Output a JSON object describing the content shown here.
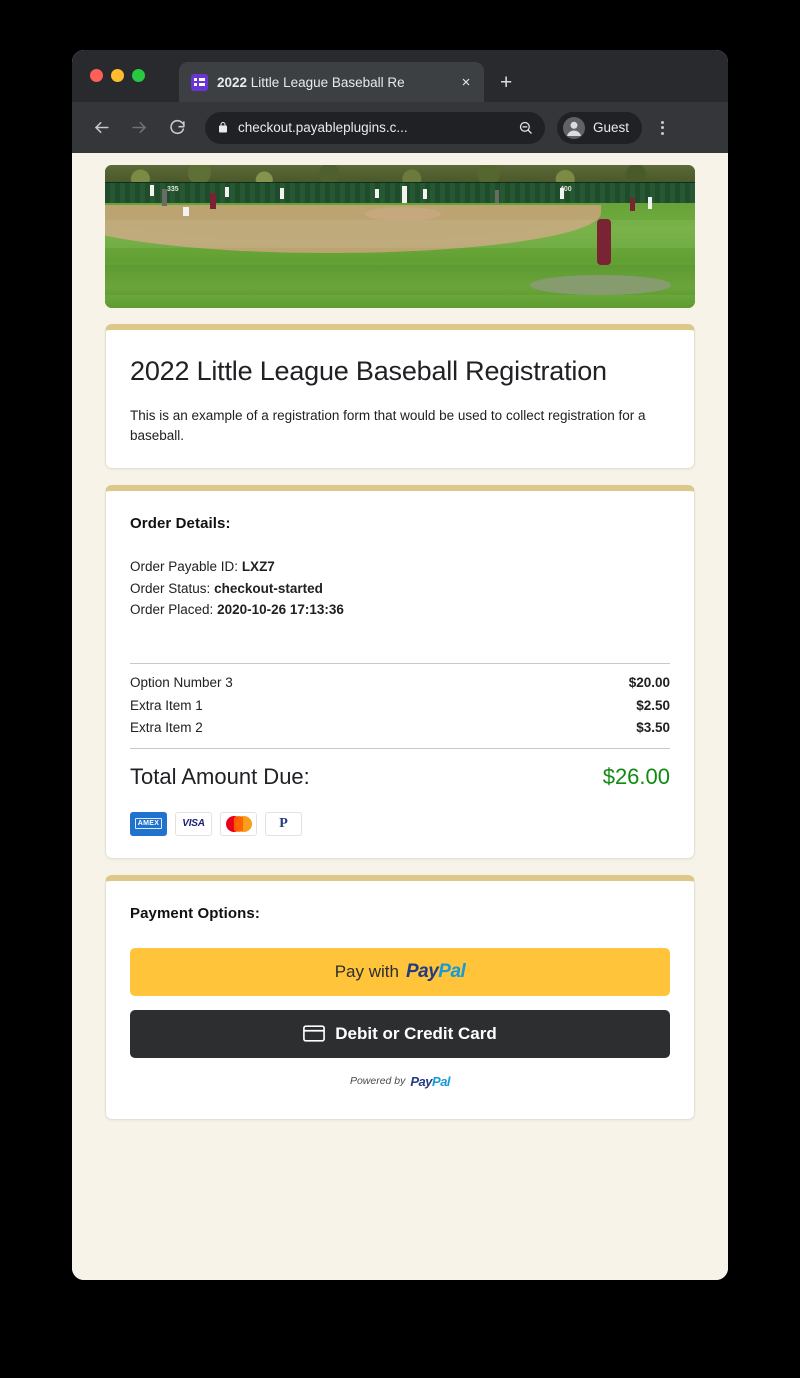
{
  "browser": {
    "tab": {
      "title_bold": "2022",
      "title_rest": " Little League Baseball Re",
      "favicon_name": "forms-list-icon",
      "close_label": "×",
      "new_tab_label": "+"
    },
    "toolbar": {
      "back_icon": "arrow-left-icon",
      "forward_icon": "arrow-right-icon",
      "reload_icon": "reload-icon",
      "lock_icon": "lock-icon",
      "url": "checkout.payableplugins.c...",
      "zoom_out_icon": "zoom-out-icon",
      "profile_label": "Guest",
      "profile_icon": "account-circle-icon",
      "menu_icon": "kebab-menu-icon"
    }
  },
  "page": {
    "background_color": "#f7f3e9",
    "accent_color": "#ddc888",
    "hero": {
      "alt": "baseball-field-photo",
      "fence_numbers": [
        "335",
        "400"
      ]
    },
    "form_card": {
      "title": "2022 Little League Baseball Registration",
      "description": "This is an example of a registration form that would be used to collect registration for a baseball."
    },
    "order_card": {
      "heading": "Order Details:",
      "meta": [
        {
          "label": "Order Payable ID:",
          "value": "LXZ7"
        },
        {
          "label": "Order Status:",
          "value": "checkout-started"
        },
        {
          "label": "Order Placed:",
          "value": "2020-10-26 17:13:36"
        }
      ],
      "items": [
        {
          "name": "Option Number 3",
          "amount": "$20.00"
        },
        {
          "name": "Extra Item 1",
          "amount": "$2.50"
        },
        {
          "name": "Extra Item 2",
          "amount": "$3.50"
        }
      ],
      "total_label": "Total Amount Due:",
      "total_amount": "$26.00",
      "total_color": "#118a11",
      "card_brands": [
        {
          "name": "amex",
          "label": "AMEX"
        },
        {
          "name": "visa",
          "label": "VISA"
        },
        {
          "name": "mastercard",
          "label": ""
        },
        {
          "name": "paypal",
          "label": "P"
        }
      ]
    },
    "payment_card": {
      "heading": "Payment Options:",
      "paypal_button": {
        "prefix": "Pay with",
        "logo_pay": "Pay",
        "logo_pal": "Pal",
        "background_color": "#ffc439"
      },
      "card_button": {
        "label": "Debit or Credit Card",
        "icon": "credit-card-icon",
        "background_color": "#2c2e2f"
      },
      "powered_by": {
        "prefix": "Powered by",
        "logo_pay": "Pay",
        "logo_pal": "Pal"
      }
    }
  }
}
